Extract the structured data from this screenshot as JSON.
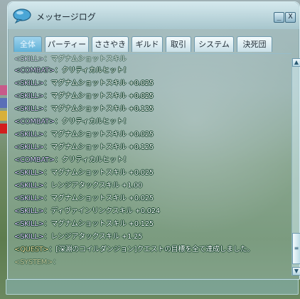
{
  "window": {
    "title": "メッセージログ",
    "minimize_glyph": "_",
    "close_glyph": "X"
  },
  "tabs": [
    {
      "label": "全体",
      "active": true
    },
    {
      "label": "パーティー",
      "active": false
    },
    {
      "label": "ささやき",
      "active": false
    },
    {
      "label": "ギルド",
      "active": false
    },
    {
      "label": "取引",
      "active": false
    },
    {
      "label": "システム",
      "active": false
    },
    {
      "label": "決死団",
      "active": false
    }
  ],
  "log": [
    {
      "tag": "<COMBAT>",
      "text": "：クリティカルヒット！"
    },
    {
      "tag": "<SKILL>",
      "text": "：マグナムショットスキル +0.025"
    },
    {
      "tag": "<SKILL>",
      "text": "：マグナムショットスキル +0.025"
    },
    {
      "tag": "<SKILL>",
      "text": "：マグナムショットスキル +0.125"
    },
    {
      "tag": "<COMBAT>",
      "text": "：クリティカルヒット！"
    },
    {
      "tag": "<SKILL>",
      "text": "：マグナムショットスキル +0.025"
    },
    {
      "tag": "<SKILL>",
      "text": "：マグナムショットスキル +0.125"
    },
    {
      "tag": "<COMBAT>",
      "text": "：クリティカルヒット！"
    },
    {
      "tag": "<SKILL>",
      "text": "：マグナムショットスキル +0.025"
    },
    {
      "tag": "<SKILL>",
      "text": "：レンジアタックスキル +1.00"
    },
    {
      "tag": "<SKILL>",
      "text": "：マグナムショットスキル +0.025"
    },
    {
      "tag": "<SKILL>",
      "text": "：ディヴァインリンクスキル +0.024"
    },
    {
      "tag": "<SKILL>",
      "text": "：マグナムショットスキル +0.125"
    },
    {
      "tag": "<SKILL>",
      "text": "：レンジアタックスキル +1.25"
    },
    {
      "tag": "<QUEST>",
      "text": "：[深淵のコイルダンジョン]クエストの目標を全て達成しました。"
    }
  ],
  "colors": {
    "active_tab": "#5fb1d8",
    "text_outline": "#0b3a24"
  },
  "icons": {
    "title": "speech-bubble-icon",
    "scroll_up": "arrow-up-icon",
    "scroll_down": "arrow-down-icon",
    "scroll_thumb": "grip-icon"
  },
  "scroll": {
    "position": 0.85
  }
}
